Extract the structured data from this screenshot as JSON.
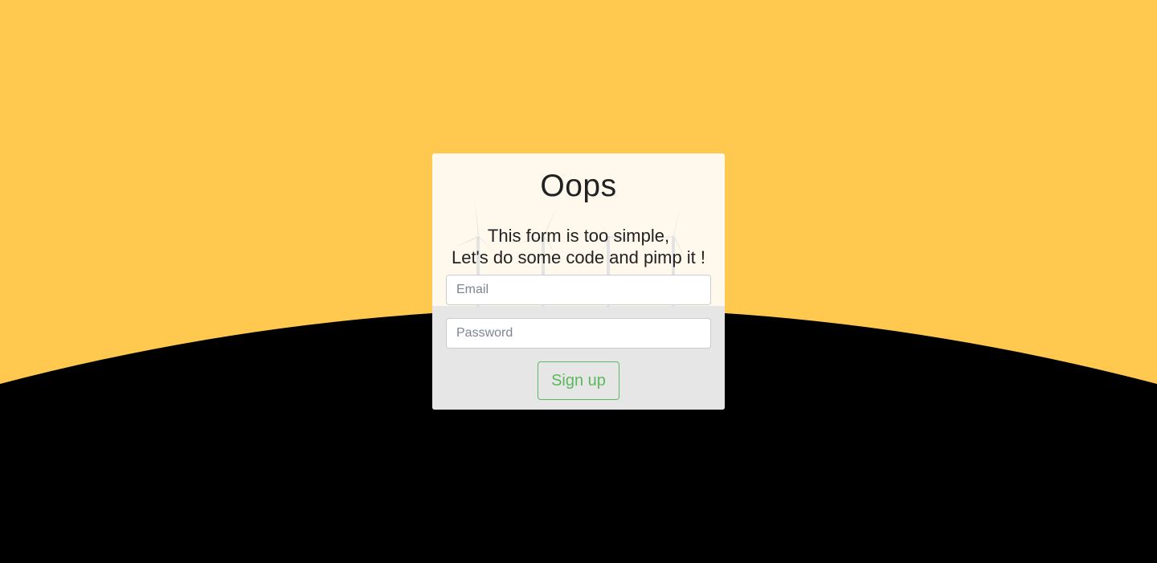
{
  "colors": {
    "sky": "#ffc84f",
    "ground": "#000000",
    "card_top": "#fff8ec",
    "card_bottom": "#e6e6e6",
    "accent": "#5cb85c"
  },
  "card": {
    "title": "Oops",
    "subtitle_line1": "This form is too simple,",
    "subtitle_line2": "Let's do some code and pimp it !",
    "decoration": "windmill-icons"
  },
  "form": {
    "email_placeholder": "Email",
    "password_placeholder": "Password",
    "submit_label": "Sign up"
  }
}
